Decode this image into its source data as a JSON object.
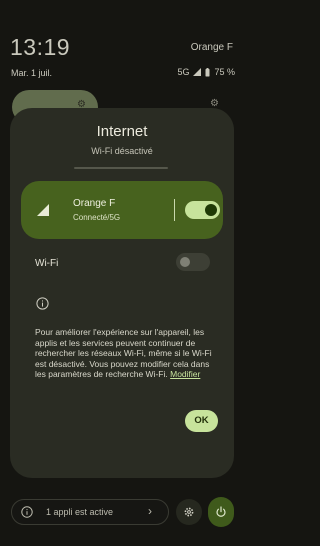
{
  "status_bar": {
    "time": "13:19",
    "carrier": "Orange F",
    "date": "Mar. 1 juil.",
    "network_type": "5G",
    "battery": "75 %"
  },
  "dialog": {
    "title": "Internet",
    "subtitle": "Wi-Fi désactivé",
    "network": {
      "name": "Orange F",
      "status": "Connecté/5G",
      "enabled": true
    },
    "wifi": {
      "label": "Wi-Fi",
      "enabled": false
    },
    "info_text": "Pour améliorer l'expérience sur l'appareil, les applis et les services peuvent continuer de rechercher les réseaux Wi-Fi, même si le Wi-Fi est désactivé. Vous pouvez modifier cela dans les paramètres de recherche Wi-Fi.",
    "info_link": "Modifier",
    "ok_label": "OK"
  },
  "bottom_bar": {
    "active_apps": "1 appli est active"
  },
  "colors": {
    "accent": "#c7e39c",
    "card": "#47621e",
    "dialog_bg": "#2a2c23",
    "screen_bg": "#151511"
  }
}
